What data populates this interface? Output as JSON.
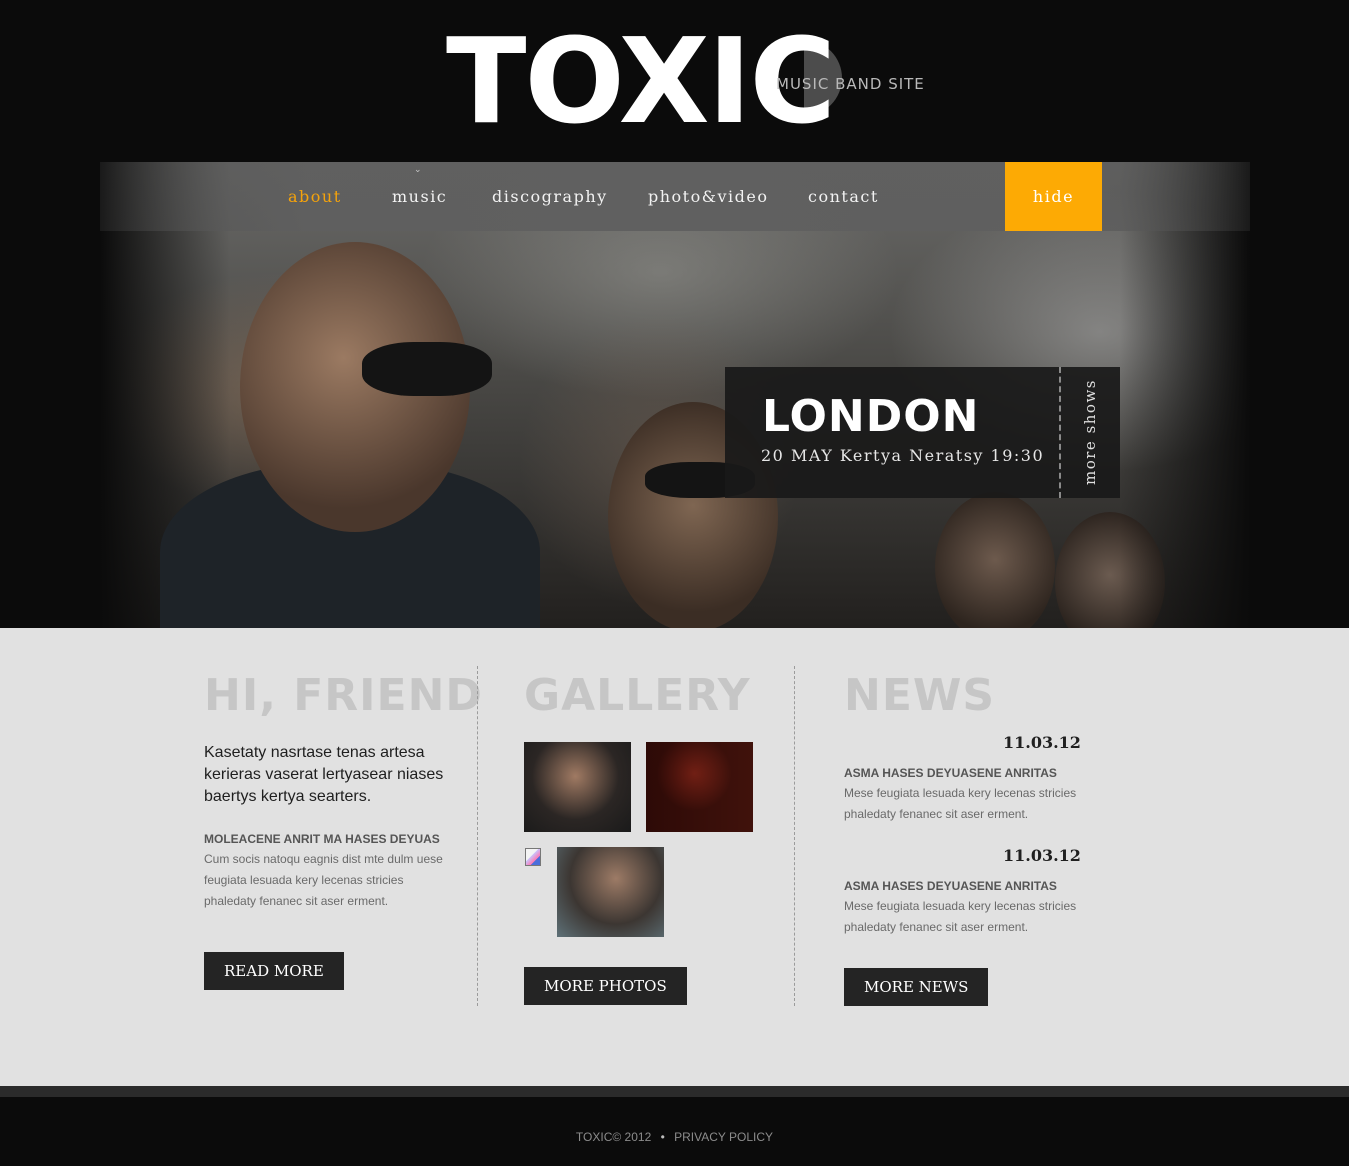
{
  "header": {
    "logo_text": "TOXIC",
    "tagline": "MUSIC BAND SITE"
  },
  "nav": {
    "items": [
      {
        "label": "about",
        "active": true
      },
      {
        "label": "music",
        "active": false
      },
      {
        "label": "discography",
        "active": false
      },
      {
        "label": "photo&video",
        "active": false
      },
      {
        "label": "contact",
        "active": false
      }
    ],
    "hide_label": "hide",
    "accent_color": "#fdaa04"
  },
  "hero": {
    "show": {
      "city": "LONDON",
      "details": "20 MAY Kertya Neratsy 19:30",
      "more_label": "more shows"
    }
  },
  "about": {
    "heading": "HI, FRIEND",
    "intro": "Kasetaty nasrtase tenas artesa kerieras vaserat lertyasear niases baertys kertya searters.",
    "subheading": "MOLEACENE ANRIT MA HASES DEYUAS",
    "text": "Cum socis natoqu eagnis dist mte dulm uese feugiata lesuada kery lecenas stricies phaledaty fenanec sit aser erment.",
    "button_label": "READ MORE"
  },
  "gallery": {
    "heading": "GALLERY",
    "button_label": "MORE PHOTOS"
  },
  "news": {
    "heading": "NEWS",
    "items": [
      {
        "date": "11.03.12",
        "title": "ASMA HASES DEYUASENE ANRITAS",
        "text": "Mese feugiata lesuada kery lecenas stricies phaledaty fenanec sit aser erment."
      },
      {
        "date": "11.03.12",
        "title": "ASMA HASES DEYUASENE ANRITAS",
        "text": "Mese feugiata lesuada kery lecenas stricies phaledaty fenanec sit aser erment."
      }
    ],
    "button_label": "MORE NEWS"
  },
  "footer": {
    "copyright": "TOXIC© 2012",
    "separator": "•",
    "privacy_label": "PRIVACY POLICY"
  }
}
